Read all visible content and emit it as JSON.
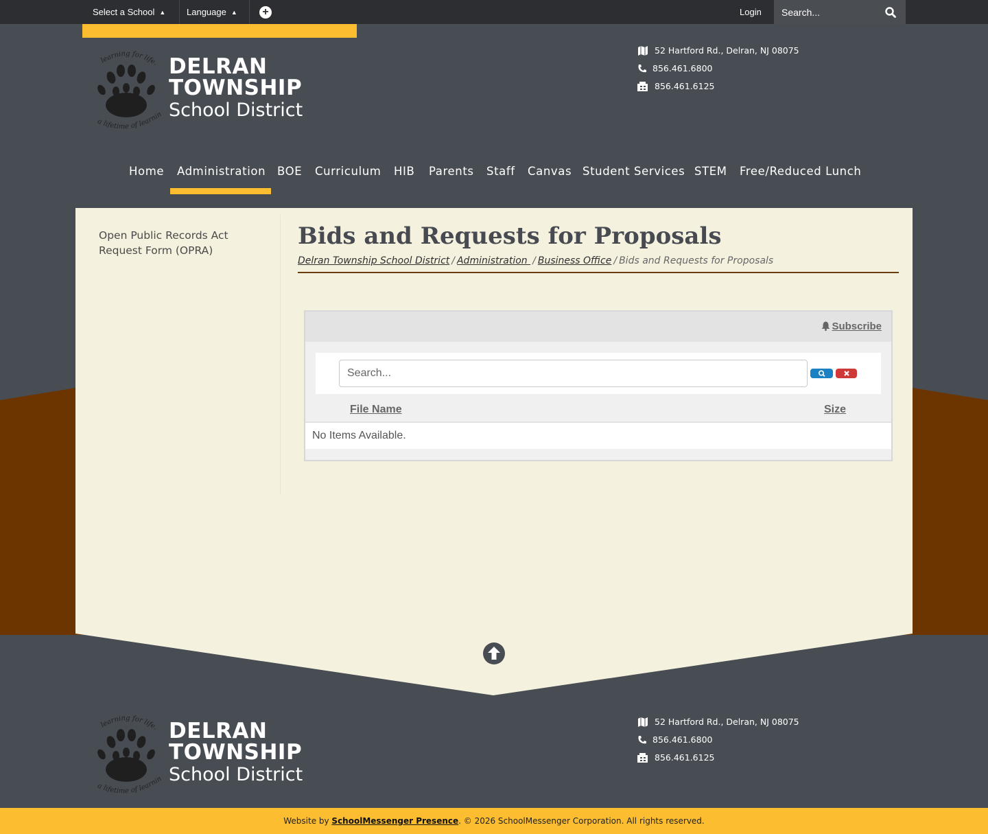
{
  "topbar": {
    "select_school": "Select a School",
    "language": "Language",
    "login": "Login",
    "search_placeholder": "Search..."
  },
  "brand": {
    "line1": "DELRAN",
    "line2": "TOWNSHIP",
    "line3": "School District",
    "seal_top": "learning for life...",
    "seal_bottom": "a lifetime of learning"
  },
  "contact": {
    "address": "52 Hartford Rd., Delran, NJ 08075",
    "phone": "856.461.6800",
    "fax": "856.461.6125"
  },
  "nav": {
    "items": [
      "Home",
      "Administration",
      "BOE",
      "Curriculum",
      "HIB",
      "Parents",
      "Staff",
      "Canvas",
      "Student Services",
      "STEM",
      "Free/Reduced Lunch"
    ],
    "active": "Administration"
  },
  "sidebar": {
    "link": "Open Public Records Act Request Form (OPRA)"
  },
  "page": {
    "title": "Bids and Requests for Proposals",
    "breadcrumb": [
      "Delran Township School District",
      "Administration ",
      "Business Office",
      "Bids and Requests for Proposals"
    ]
  },
  "files": {
    "subscribe": "Subscribe",
    "search_placeholder": "Search...",
    "col_name": "File Name",
    "col_size": "Size",
    "empty": "No Items Available."
  },
  "footer": {
    "prefix": "Website by ",
    "vendor": "SchoolMessenger Presence",
    "suffix": ". © 2026 SchoolMessenger Corporation. All rights reserved."
  },
  "colors": {
    "accent": "#fcbd31",
    "header_bg": "#484d53",
    "band": "#6c3500",
    "panel": "#f5f1df",
    "search_btn": "#1c81c3",
    "clear_btn": "#cf3a37"
  },
  "icons": [
    "caret-updown-icon",
    "plus-circle-icon",
    "search-icon",
    "map-icon",
    "phone-icon",
    "fax-icon",
    "bell-icon",
    "close-icon",
    "arrow-up-circle-icon",
    "paw-logo-icon"
  ]
}
